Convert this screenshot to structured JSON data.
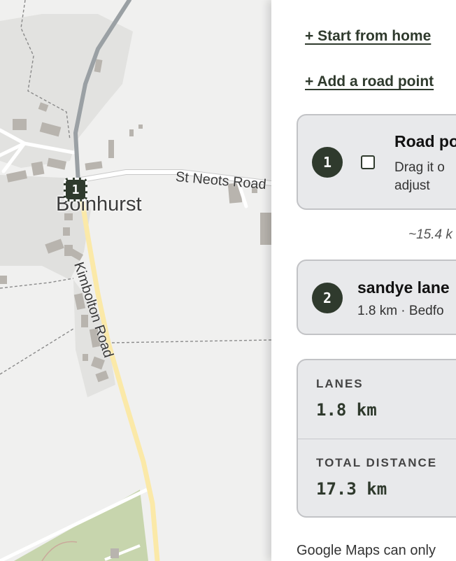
{
  "map": {
    "village_name": "Bolnhurst",
    "road_st_neots": "St Neots Road",
    "road_kimbolton": "Kimbolton Road",
    "marker_number": "1",
    "colors": {
      "background": "#f0f0ef",
      "route_grey": "#9aa0a4",
      "route_yellow": "#fbe9a8",
      "field_green": "#c7d5ad",
      "marker": "#2f3a2d"
    }
  },
  "panel": {
    "start_from_home": "+ Start from home",
    "add_road_point": "+ Add a road point",
    "road_point_card": {
      "number": "1",
      "title": "Road po",
      "desc_line1": "Drag it o",
      "desc_line2": "adjust"
    },
    "segment_distance": "~15.4 k",
    "lane_card": {
      "number": "2",
      "title": "sandye lane",
      "meta": "1.8 km · Bedfo"
    },
    "stats": {
      "lanes_label": "LANES",
      "lanes_value": "1.8 km",
      "total_label": "TOTAL DISTANCE",
      "total_value": "17.3 km"
    },
    "footer_note": "Google Maps can only"
  },
  "theme": {
    "accent": "#2f3a2d",
    "card_bg": "#e8e9eb",
    "card_border": "#c2c3c6"
  }
}
